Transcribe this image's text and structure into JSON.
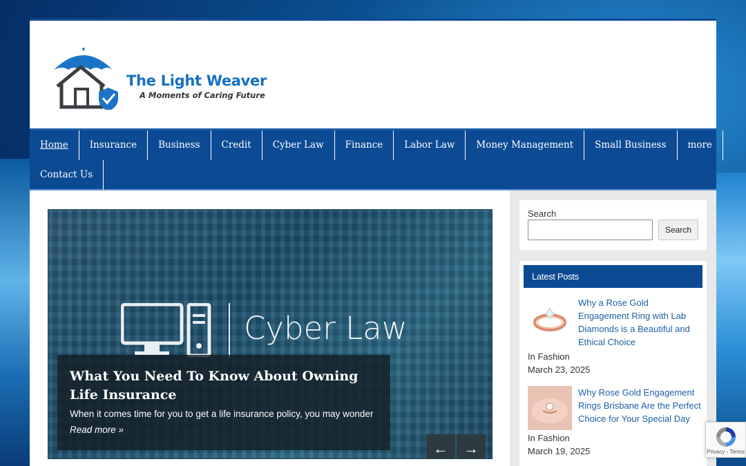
{
  "site": {
    "title": "The Light Weaver",
    "tagline": "A Moments of Caring Future"
  },
  "nav": {
    "row1": [
      "Home",
      "Insurance",
      "Business",
      "Credit",
      "Cyber Law",
      "Finance",
      "Labor Law",
      "Money Management",
      "Small Business",
      "more"
    ],
    "row2": [
      "Contact Us"
    ],
    "active": "Home"
  },
  "slider": {
    "image_label": "Cyber Law",
    "heading": "What You Need To Know About Owning Life Insurance",
    "excerpt": "When it comes time for you to get a life insurance policy, you may wonder",
    "read_more": "Read more »",
    "prev_icon": "arrow-left-icon",
    "next_icon": "arrow-right-icon"
  },
  "sidebar": {
    "search_label": "Search",
    "search_value": "",
    "search_button": "Search",
    "latest_title": "Latest Posts",
    "posts": [
      {
        "title": "Why a Rose Gold Engagement Ring with Lab Diamonds is a Beautiful and Ethical Choice",
        "category": "In Fashion",
        "date": "March 23, 2025"
      },
      {
        "title": "Why Rose Gold Engagement Rings Brisbane Are the Perfect Choice for Your Special Day",
        "category": "In Fashion",
        "date": "March 19, 2025"
      }
    ]
  },
  "recaptcha": {
    "links": "Privacy - Terms"
  },
  "colors": {
    "brand_blue": "#0d4a94",
    "link_blue": "#1d5fa8",
    "logo_blue": "#1571c1"
  }
}
